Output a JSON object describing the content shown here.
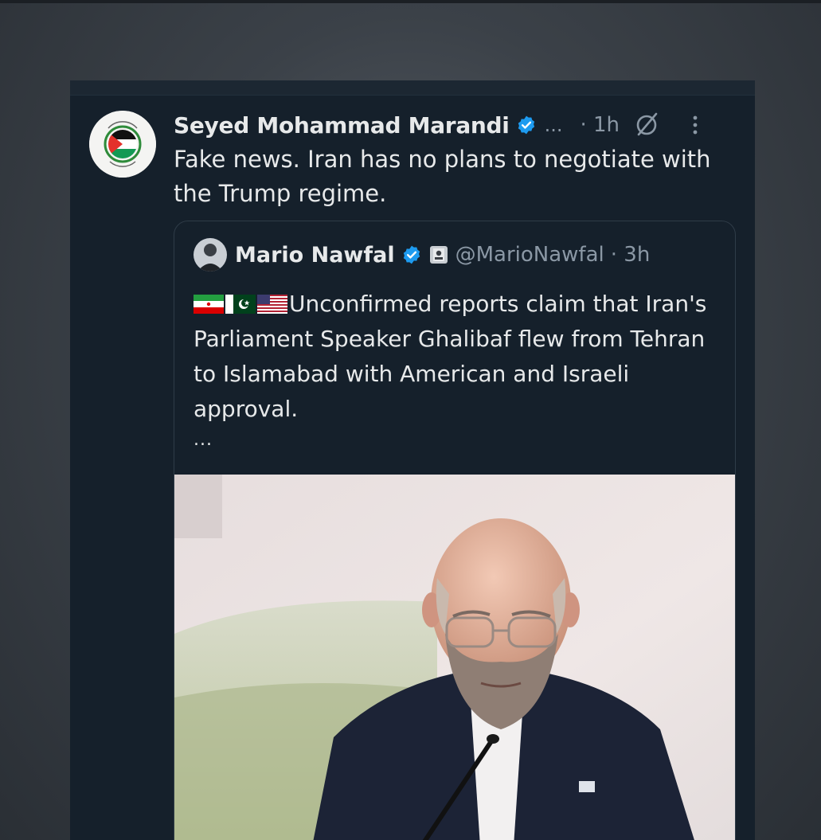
{
  "tweet": {
    "author_name": "Seyed Mohammad Marandi",
    "handle_truncated": "...",
    "time": "· 1h",
    "text": "Fake news. Iran has no plans to negotiate with the Trump regime.",
    "icons": [
      "verified-badge-icon",
      "grok-icon",
      "more-options-icon"
    ]
  },
  "quoted_tweet": {
    "author_name": "Mario Nawfal",
    "handle": "@MarioNawfal",
    "time": "· 3h",
    "flags": [
      "iran-flag-icon",
      "pakistan-flag-icon",
      "us-flag-icon"
    ],
    "text": "Unconfirmed reports claim that Iran's Parliament Speaker Ghalibaf flew from Tehran to Islamabad with American and Israeli approval.",
    "more": "...",
    "media_description_icon": "photo-man-at-microphone"
  },
  "colors": {
    "background": "#15202b",
    "text": "#e7e9ea",
    "secondary_text": "#8b98a5",
    "verified_blue": "#1d9bf0",
    "border": "#2f3c48"
  }
}
